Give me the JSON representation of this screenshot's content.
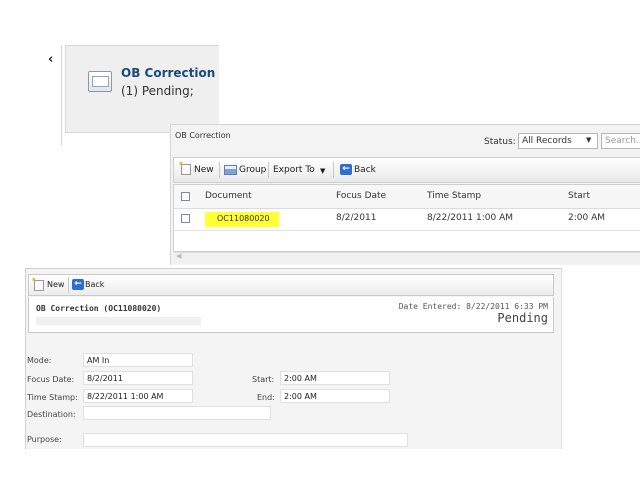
{
  "summary": {
    "back_icon": "chevron-left-icon",
    "chevron": "‹",
    "title": "OB Correction",
    "pending": "(1) Pending;"
  },
  "list": {
    "title": "OB Correction",
    "status_label": "Status:",
    "status_value": "All Records",
    "search_placeholder": "Search...",
    "toolbar": {
      "new": "New",
      "group": "Group",
      "export": "Export To",
      "back": "Back"
    },
    "columns": [
      "Document",
      "Focus Date",
      "Time Stamp",
      "Start"
    ],
    "rows": [
      {
        "document": "OC11080020",
        "focus_date": "8/2/2011",
        "time_stamp": "8/22/2011 1:00 AM",
        "start": "2:00 AM"
      }
    ],
    "highlight_color": "#ffff33"
  },
  "detail": {
    "toolbar": {
      "new": "New",
      "back": "Back"
    },
    "title": "OB Correction (OC11080020)",
    "date_entered": "Date Entered: 8/22/2011 6:33 PM",
    "status": "Pending",
    "fields": {
      "mode_label": "Mode:",
      "mode_value": "AM In",
      "focus_date_label": "Focus Date:",
      "focus_date_value": "8/2/2011",
      "time_stamp_label": "Time Stamp:",
      "time_stamp_value": "8/22/2011 1:00 AM",
      "destination_label": "Destination:",
      "destination_value": "",
      "purpose_label": "Purpose:",
      "purpose_value": "",
      "start_label": "Start:",
      "start_value": "2:00 AM",
      "end_label": "End:",
      "end_value": "2:00 AM"
    }
  },
  "colors": {
    "title_blue": "#1a4a7a",
    "back_blue": "#2d6fcf"
  }
}
